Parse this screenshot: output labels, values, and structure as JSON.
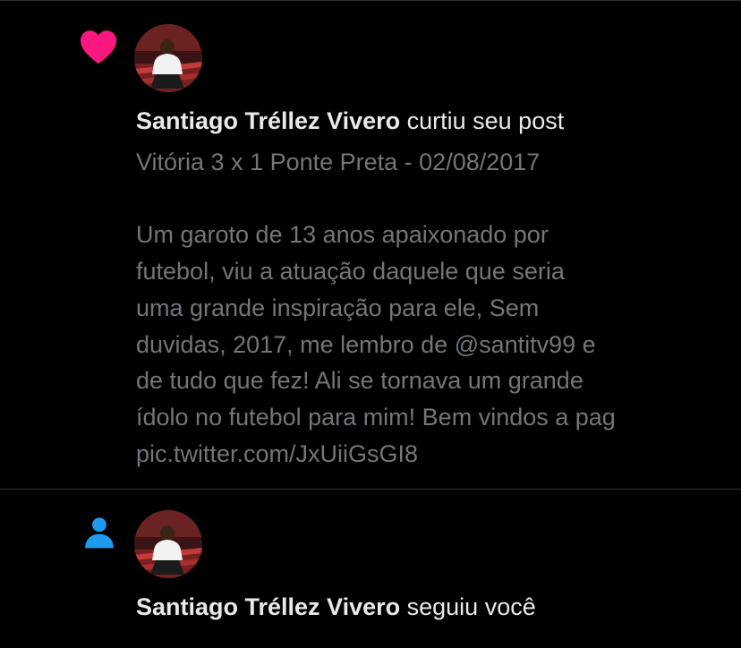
{
  "colors": {
    "background": "#000000",
    "primary_text": "#e7e9ea",
    "secondary_text": "#71767b",
    "divider": "#2f3336",
    "like_heart": "#f91880",
    "follow_person": "#1d9bf0"
  },
  "notifications": [
    {
      "type": "like",
      "icon": "heart-icon",
      "actor_name": "Santiago Tréllez Vivero",
      "action_text": " curtiu seu post",
      "post_lines": [
        "Vitória 3 x 1 Ponte Preta - 02/08/2017",
        "",
        "Um garoto de 13 anos apaixonado por",
        "futebol, viu a atuação daquele que seria",
        "uma grande inspiração para ele, Sem",
        "duvidas, 2017, me lembro de @santitv99 e",
        "de tudo que fez! Ali se tornava um grande",
        "ídolo no futebol para mim! Bem vindos a pag",
        "pic.twitter.com/JxUiiGsGI8"
      ]
    },
    {
      "type": "follow",
      "icon": "person-icon",
      "actor_name": "Santiago Tréllez Vivero",
      "action_text": " seguiu você"
    }
  ]
}
